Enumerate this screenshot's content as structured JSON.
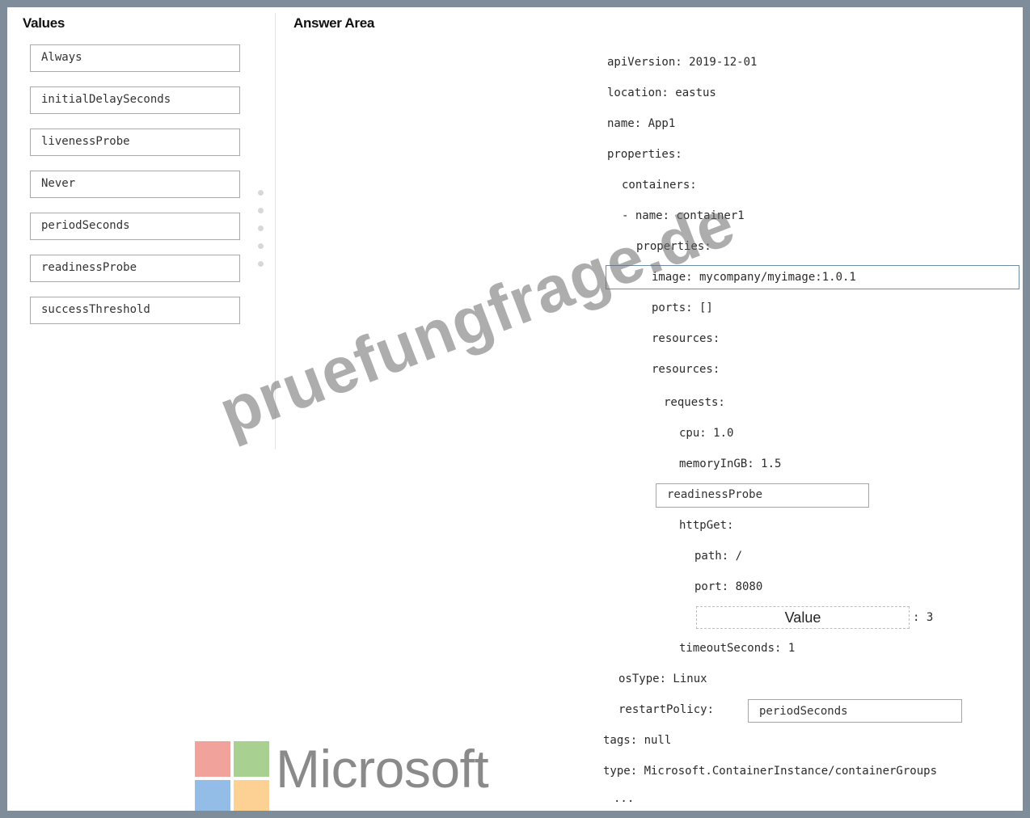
{
  "headings": {
    "values": "Values",
    "answer_area": "Answer Area"
  },
  "values": [
    "Always",
    "initialDelaySeconds",
    "livenessProbe",
    "Never",
    "periodSeconds",
    "readinessProbe",
    "successThreshold"
  ],
  "yaml": {
    "api_version": "apiVersion: 2019-12-01",
    "location": "location: eastus",
    "name": "name: App1",
    "properties": "properties:",
    "containers": "containers:",
    "container_name": "- name: container1",
    "container_properties": "properties:",
    "image": "image: mycompany/myimage:1.0.1",
    "ports": "ports: []",
    "resources_1": "resources:",
    "resources_2": "resources:",
    "requests": "requests:",
    "cpu": "cpu: 1.0",
    "memory": "memoryInGB: 1.5",
    "http_get": "httpGet:",
    "path": "path: /",
    "port": "port: 8080",
    "value_suffix": ": 3",
    "timeout": "timeoutSeconds: 1",
    "os_type": "osType: Linux",
    "restart_policy": "restartPolicy:",
    "tags": "tags: null",
    "type": "type: Microsoft.ContainerInstance/containerGroups",
    "ellipsis": "..."
  },
  "drop_slots": {
    "probe": "readinessProbe",
    "threshold": "Value",
    "restart_policy": "periodSeconds"
  },
  "watermark": "pruefungfrage.de",
  "brand": {
    "text": "Microsoft",
    "colors": [
      "#f1a29a",
      "#a8d191",
      "#93bde6",
      "#fdd093"
    ]
  }
}
